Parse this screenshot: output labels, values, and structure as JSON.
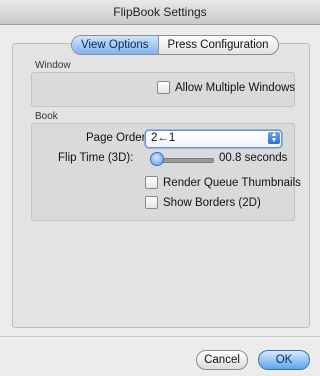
{
  "window": {
    "title": "FlipBook Settings"
  },
  "tabs": [
    {
      "label": "View Options",
      "selected": true
    },
    {
      "label": "Press Configuration",
      "selected": false
    }
  ],
  "window_group": {
    "title": "Window",
    "allow_multiple_label": "Allow Multiple Windows",
    "allow_multiple_checked": false
  },
  "book_group": {
    "title": "Book",
    "page_order_label": "Page Order:",
    "page_order_value": "2←1",
    "flip_time_label": "Flip Time (3D):",
    "flip_time_value": "00.8 seconds",
    "render_queue_label": "Render Queue Thumbnails",
    "render_queue_checked": false,
    "show_borders_label": "Show Borders (2D)",
    "show_borders_checked": false
  },
  "buttons": {
    "cancel": "Cancel",
    "ok": "OK"
  },
  "colors": {
    "accent": "#5ea3ee"
  }
}
